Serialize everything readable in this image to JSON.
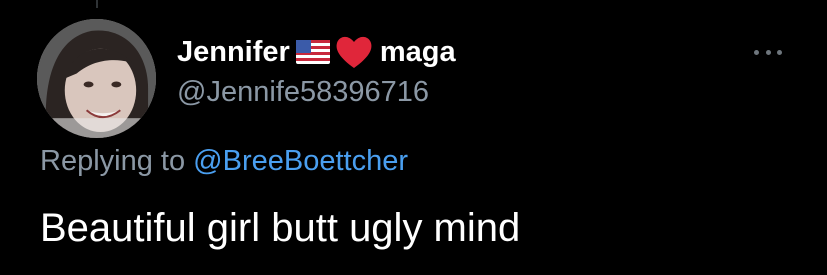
{
  "tweet": {
    "author": {
      "display_name": "Jennifer",
      "name_suffix": "maga",
      "handle": "@Jennife58396716",
      "flag_icon": "us-flag-icon",
      "heart_icon": "red-heart-icon"
    },
    "more_icon": "more-dots-icon",
    "replying_to_label": "Replying to",
    "replying_to_user": "@BreeBoettcher",
    "text": "Beautiful girl butt ugly mind"
  },
  "colors": {
    "background": "#000000",
    "primary_text": "#ffffff",
    "secondary_text": "#8b98a5",
    "link": "#4a9ff0",
    "heart": "#e0263a"
  }
}
